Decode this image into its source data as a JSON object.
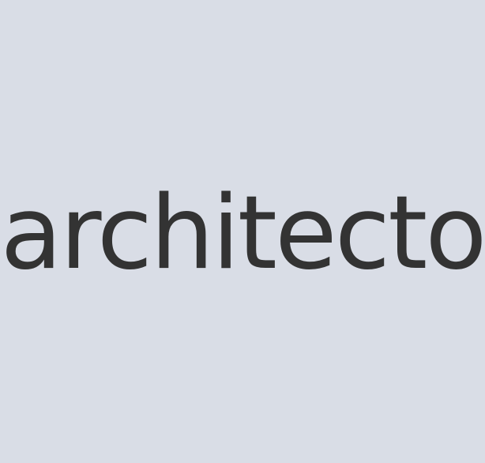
{
  "screen": {
    "text": "architecto",
    "background_color": "#d9dde6",
    "text_color": "#333333"
  }
}
